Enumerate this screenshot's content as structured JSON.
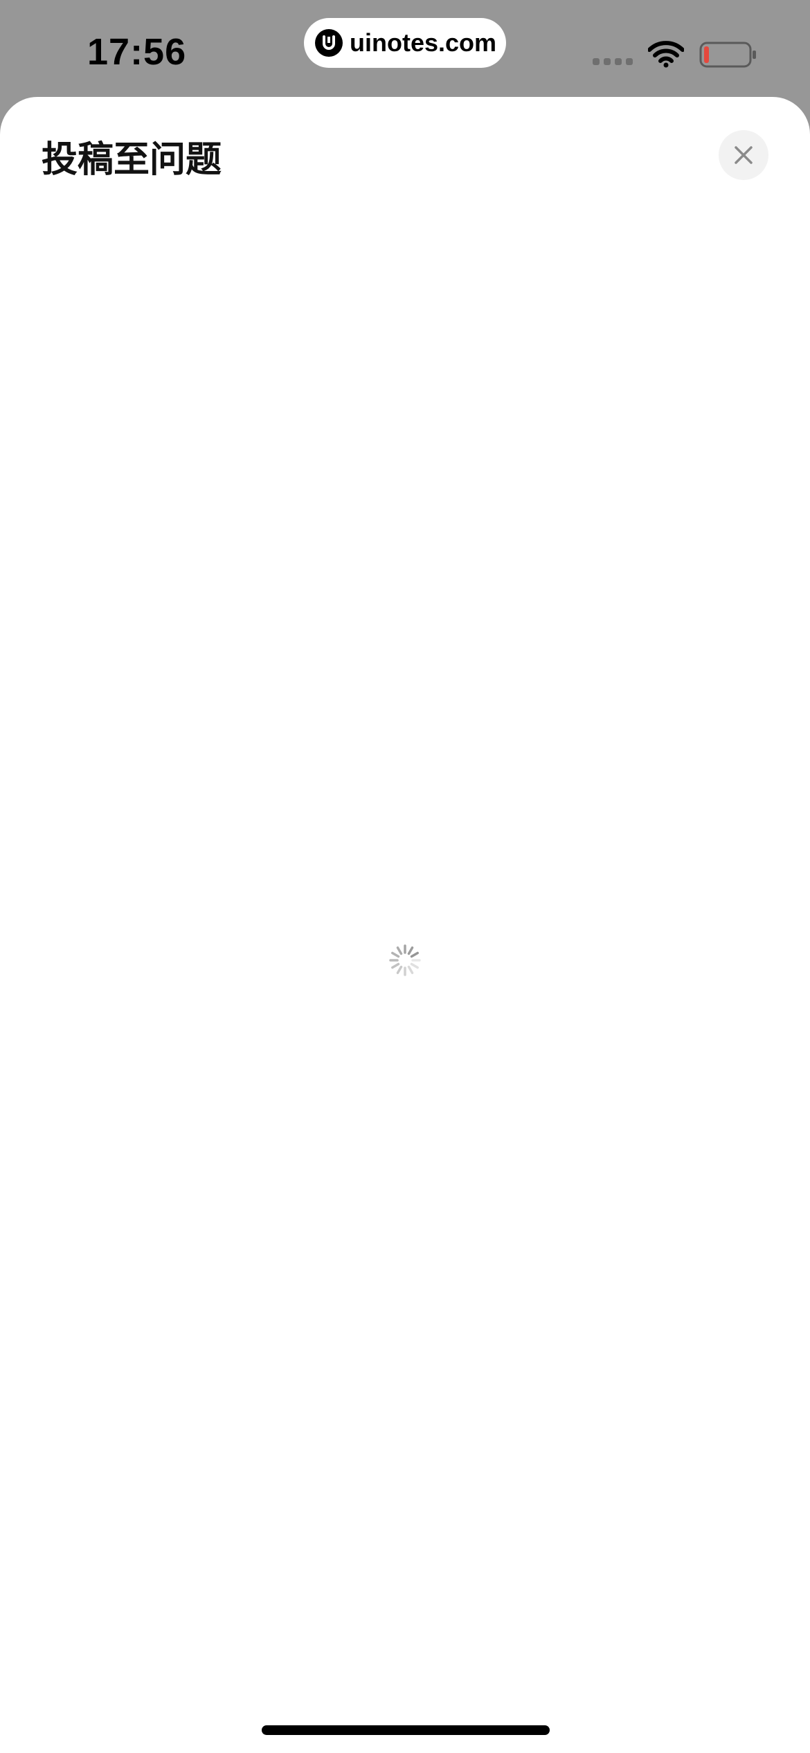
{
  "status_bar": {
    "time": "17:56",
    "url": "uinotes.com",
    "battery_color": "#e5483d"
  },
  "sheet": {
    "title": "投稿至问题",
    "close_icon": "close-icon"
  },
  "loading": {
    "icon": "spinner-icon"
  }
}
